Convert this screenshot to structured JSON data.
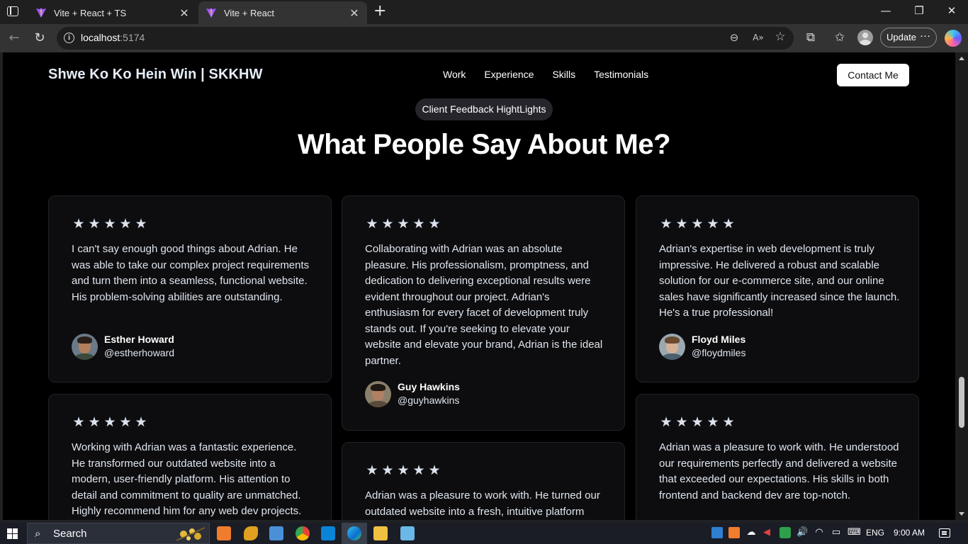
{
  "browser": {
    "tabs": [
      {
        "title": "Vite + React + TS",
        "active": false
      },
      {
        "title": "Vite + React",
        "active": true
      }
    ],
    "new_tab_icon": "+",
    "window_controls": {
      "minimize": "—",
      "restore": "❐",
      "close": "✕"
    },
    "url_host": "localhost",
    "url_port": ":5174",
    "update_label": "Update",
    "more_icon": "···"
  },
  "site": {
    "brand": "Shwe Ko Ko Hein Win | SKKHW",
    "nav": [
      "Work",
      "Experience",
      "Skills",
      "Testimonials"
    ],
    "contact_label": "Contact Me",
    "pill": "Client Feedback HightLights",
    "heading": "What People Say About Me?",
    "star_glyph": "★",
    "star_color": "#dce2ec",
    "testimonials": [
      {
        "stars": 5,
        "quote": "I can't say enough good things about Adrian. He was able to take our complex project requirements and turn them into a seamless, functional website. His problem-solving abilities are outstanding.",
        "name": "Esther Howard",
        "handle": "@estherhoward"
      },
      {
        "stars": 5,
        "quote": "Collaborating with Adrian was an absolute pleasure. His professionalism, promptness, and dedication to delivering exceptional results were evident throughout our project. Adrian's enthusiasm for every facet of development truly stands out. If you're seeking to elevate your website and elevate your brand, Adrian is the ideal partner.",
        "name": "Guy Hawkins",
        "handle": "@guyhawkins"
      },
      {
        "stars": 5,
        "quote": "Adrian's expertise in web development is truly impressive. He delivered a robust and scalable solution for our e-commerce site, and our online sales have significantly increased since the launch. He's a true professional!",
        "name": "Floyd Miles",
        "handle": "@floydmiles"
      },
      {
        "stars": 5,
        "quote": "Working with Adrian was a fantastic experience. He transformed our outdated website into a modern, user-friendly platform. His attention to detail and commitment to quality are unmatched. Highly recommend him for any web dev projects."
      },
      {
        "stars": 5,
        "quote": "Adrian was a pleasure to work with. He turned our outdated website into a fresh, intuitive platform"
      },
      {
        "stars": 5,
        "quote": "Adrian was a pleasure to work with. He understood our requirements perfectly and delivered a website that exceeded our expectations. His skills in both frontend and backend dev are top-notch."
      }
    ]
  },
  "taskbar": {
    "search_label": "Search",
    "language": "ENG",
    "time": "9:00 AM"
  }
}
